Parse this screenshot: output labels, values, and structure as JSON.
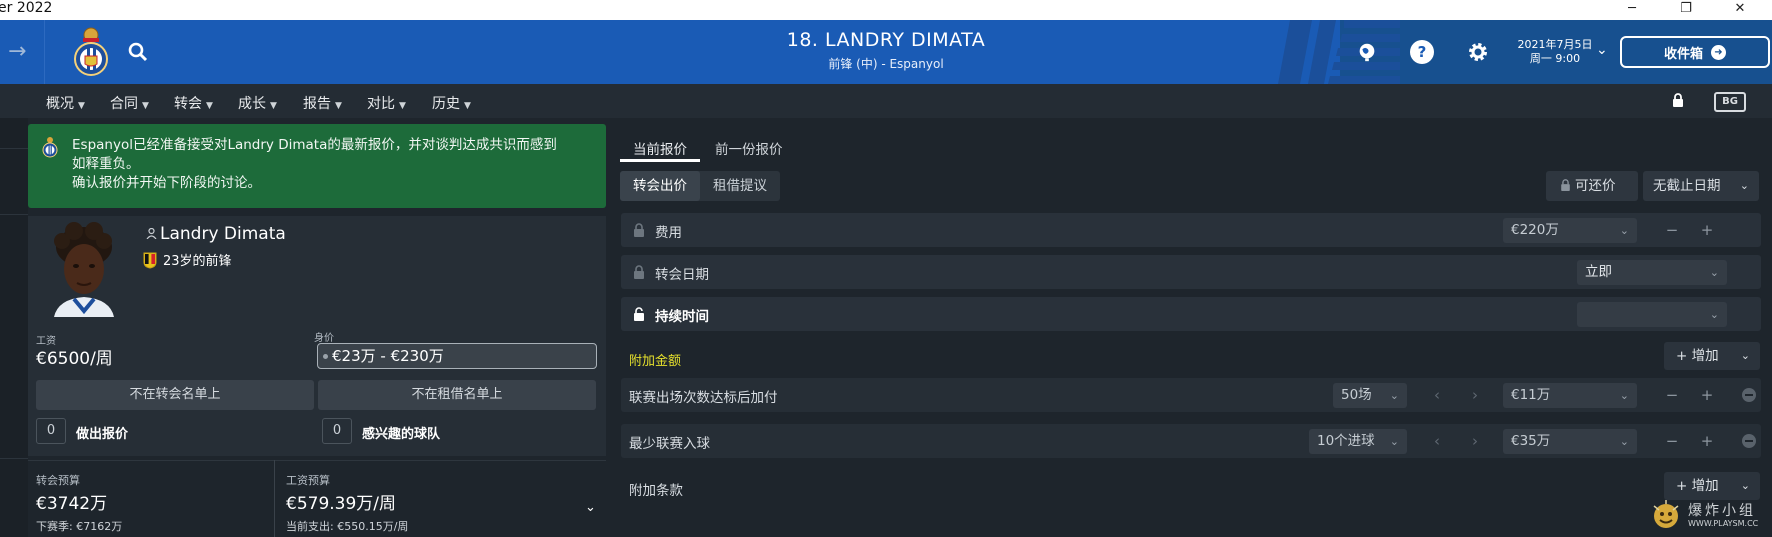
{
  "window": {
    "title_fragment": "er 2022",
    "minimize": "─",
    "restore": "❐",
    "close": "✕"
  },
  "header": {
    "player_title": "18. LANDRY DIMATA",
    "player_subtitle": "前锋 (中) - Espanyol",
    "date_line1": "2021年7月5日",
    "date_line2": "周一 9:00",
    "inbox_label": "收件箱",
    "help_glyph": "?"
  },
  "nav": {
    "items": [
      {
        "label": "概况"
      },
      {
        "label": "合同"
      },
      {
        "label": "转会"
      },
      {
        "label": "成长"
      },
      {
        "label": "报告"
      },
      {
        "label": "对比"
      },
      {
        "label": "历史"
      }
    ],
    "bg_badge": "BG"
  },
  "notice": {
    "line1": "Espanyol已经准备接受对Landry Dimata的最新报价，并对谈判达成共识而感到",
    "line2": "如释重负。",
    "line3": "确认报价并开始下阶段的讨论。",
    "background": "#1d6b3a"
  },
  "player": {
    "name": "Landry Dimata",
    "age_position": "23岁的前锋",
    "wage_label": "工资",
    "wage_value": "€6500/周",
    "value_label": "身价",
    "value_range": "€23万 - €230万",
    "transfer_list_btn": "不在转会名单上",
    "loan_list_btn": "不在租借名单上",
    "offers_count": "0",
    "offers_label": "做出报价",
    "interested_count": "0",
    "interested_label": "感兴趣的球队"
  },
  "budget": {
    "transfer_label": "转会预算",
    "transfer_value": "€3742万",
    "transfer_next": "下赛季: €7162万",
    "wage_label": "工资预算",
    "wage_value": "€579.39万/周",
    "wage_spent": "当前支出: €550.15万/周"
  },
  "offer": {
    "tabs": [
      {
        "label": "当前报价"
      },
      {
        "label": "前一份报价"
      }
    ],
    "segments": {
      "transfer": "转会出价",
      "loan": "租借提议"
    },
    "negotiable_label": "可还价",
    "deadline_label": "无截止日期",
    "fee_label": "费用",
    "fee_value": "€220万",
    "date_label": "转会日期",
    "date_value": "立即",
    "duration_label": "持续时间",
    "duration_value": "",
    "bonus_header": "附加金额",
    "bonus_header_color": "#e5e02c",
    "add_label": "增加",
    "bonuses": [
      {
        "label": "联赛出场次数达标后加付",
        "condition": "50场",
        "amount": "€11万"
      },
      {
        "label": "最少联赛入球",
        "condition": "10个进球",
        "amount": "€35万"
      }
    ],
    "clauses_header": "附加条款"
  },
  "watermark": {
    "line1": "爆炸小组",
    "line2": "WWW.PLAYSM.CC"
  },
  "colors": {
    "header_blue": "#1a5bb5",
    "panel_bg": "#1e252c",
    "accent_yellow": "#e5e02c"
  }
}
